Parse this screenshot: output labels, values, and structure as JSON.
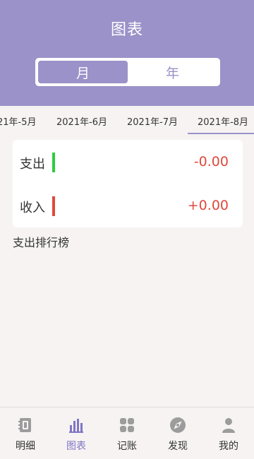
{
  "header": {
    "title": "图表"
  },
  "segment": {
    "month_label": "月",
    "year_label": "年"
  },
  "months": [
    "21年-5月",
    "2021年-6月",
    "2021年-7月",
    "2021年-8月"
  ],
  "summary": {
    "expense_label": "支出",
    "expense_value": "-0.00",
    "income_label": "收入",
    "income_value": "+0.00"
  },
  "ranking_title": "支出排行榜",
  "tabs": [
    {
      "label": "明细",
      "icon": "notebook-icon"
    },
    {
      "label": "图表",
      "icon": "bar-chart-icon"
    },
    {
      "label": "记账",
      "icon": "grid-icon"
    },
    {
      "label": "发现",
      "icon": "compass-icon"
    },
    {
      "label": "我的",
      "icon": "user-icon"
    }
  ],
  "colors": {
    "accent": "#9a92c8",
    "expense_bar": "#2ecc40",
    "income_bar": "#e0483d",
    "value_red": "#e0483d"
  }
}
